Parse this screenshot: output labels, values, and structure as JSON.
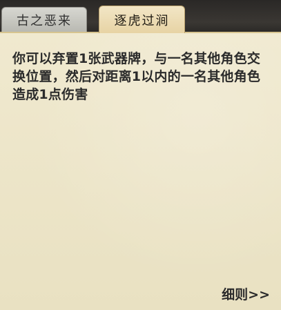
{
  "tabs": {
    "inactive_label": "古之恶来",
    "active_label": "逐虎过涧"
  },
  "skill": {
    "description": "你可以弃置1张武器牌，与一名其他角色交换位置，然后对距离1以内的一名其他角色造成1点伤害"
  },
  "footer": {
    "details_label": "细则>>"
  }
}
